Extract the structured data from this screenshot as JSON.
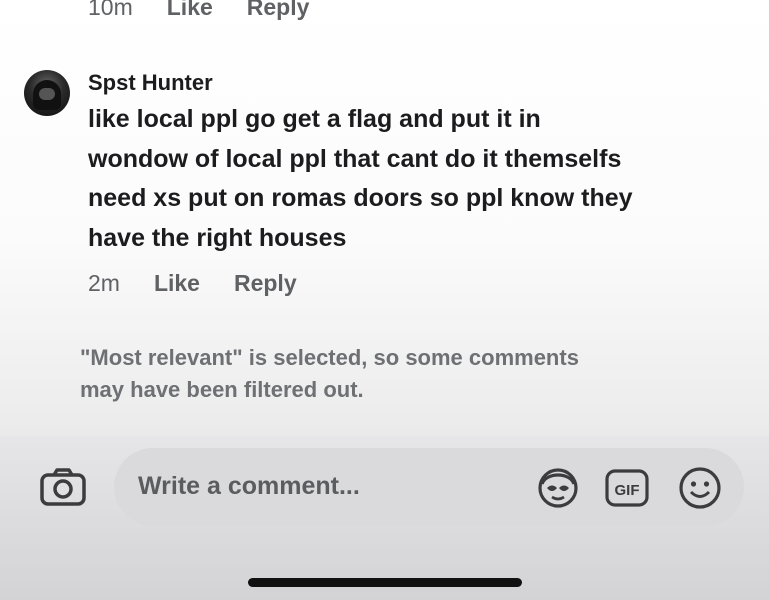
{
  "previous_comment": {
    "time": "10m",
    "like_label": "Like",
    "reply_label": "Reply"
  },
  "comment": {
    "author": "Spst Hunter",
    "text_lines": [
      "like local ppl go get a flag and put it in",
      "wondow of local ppl that cant do it themselfs",
      "need xs put on romas doors so ppl know they",
      "have the right houses"
    ],
    "time": "2m",
    "like_label": "Like",
    "reply_label": "Reply"
  },
  "filter_note": {
    "line1": "\"Most relevant\" is selected, so some comments",
    "line2": "may have been filtered out."
  },
  "composer": {
    "placeholder": "Write a comment...",
    "icons": [
      "camera-icon",
      "avatar-sticker-icon",
      "gif-icon",
      "emoji-icon"
    ],
    "gif_label": "GIF"
  }
}
